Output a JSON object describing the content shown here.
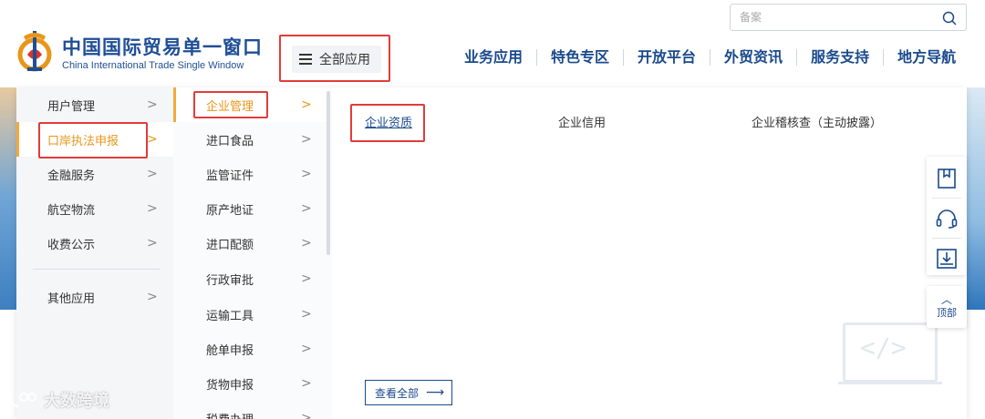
{
  "header": {
    "title_cn": "中国国际贸易单一窗口",
    "title_en": "China International Trade Single Window",
    "all_apps_label": "全部应用",
    "search_placeholder": "备案",
    "nav": [
      "业务应用",
      "特色专区",
      "开放平台",
      "外贸资讯",
      "服务支持",
      "地方导航"
    ]
  },
  "menu": {
    "level1": [
      {
        "label": "用户管理",
        "active": false
      },
      {
        "label": "口岸执法申报",
        "active": true
      },
      {
        "label": "金融服务",
        "active": false
      },
      {
        "label": "航空物流",
        "active": false
      },
      {
        "label": "收费公示",
        "active": false
      },
      {
        "label": "其他应用",
        "active": false
      }
    ],
    "level2": [
      {
        "label": "企业管理",
        "active": true
      },
      {
        "label": "进口食品",
        "active": false
      },
      {
        "label": "监管证件",
        "active": false
      },
      {
        "label": "原产地证",
        "active": false
      },
      {
        "label": "进口配额",
        "active": false
      },
      {
        "label": "行政审批",
        "active": false
      },
      {
        "label": "运输工具",
        "active": false
      },
      {
        "label": "舱单申报",
        "active": false
      },
      {
        "label": "货物申报",
        "active": false
      },
      {
        "label": "税费办理",
        "active": false
      }
    ],
    "level3": [
      {
        "label": "企业资质"
      },
      {
        "label": "企业信用"
      },
      {
        "label": "企业稽核查（主动披露）"
      }
    ],
    "view_all_label": "查看全部",
    "chevron": ">"
  },
  "toolbar": {
    "top_label": "顶部",
    "icons": [
      "bookmark-icon",
      "headset-icon",
      "download-icon"
    ]
  },
  "watermark": {
    "text": "大数跨境"
  },
  "colors": {
    "brand_blue": "#1a4a8c",
    "active_orange": "#e8961a",
    "highlight_red": "#e23b3b"
  }
}
